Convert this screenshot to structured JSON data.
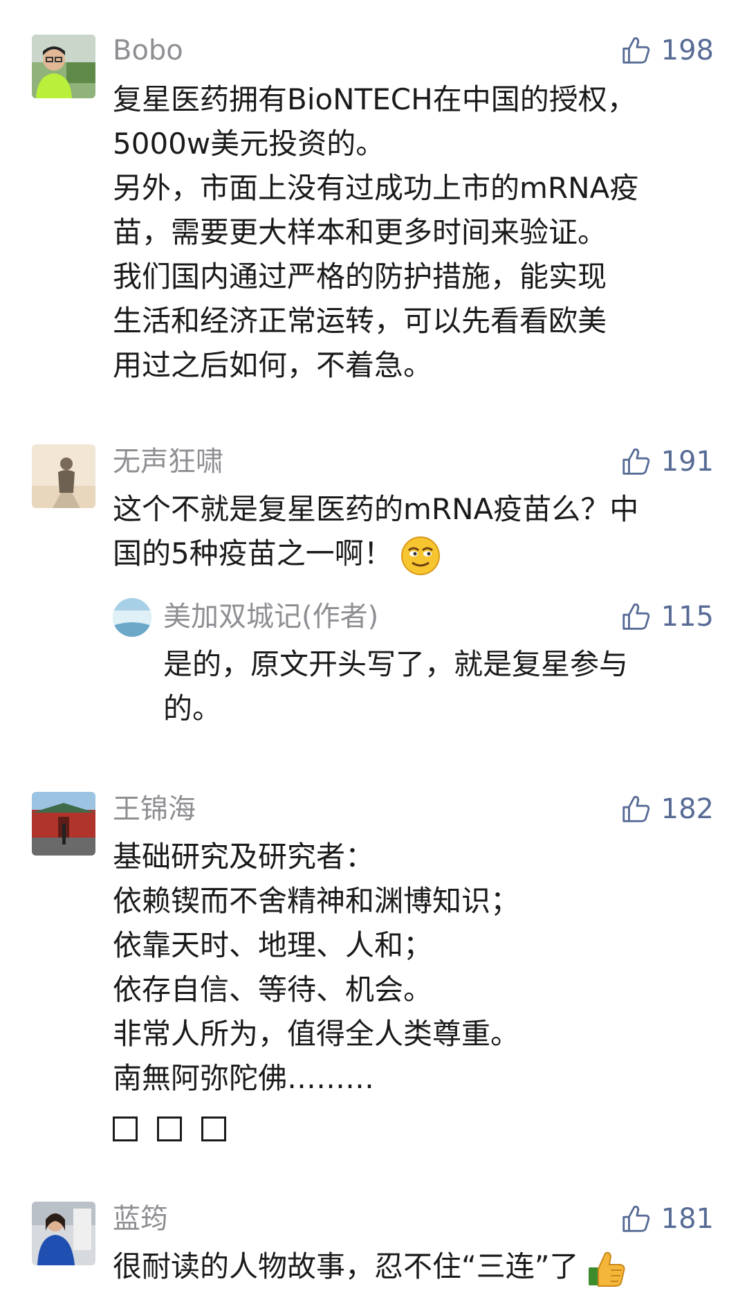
{
  "comments": [
    {
      "author": "Bobo",
      "likes": "198",
      "lines": [
        "复星医药拥有BioNTECH在中国的授权，",
        "5000w美元投资的。",
        "另外，市面上没有过成功上市的mRNA疫",
        "苗，需要更大样本和更多时间来验证。",
        "我们国内通过严格的防护措施，能实现",
        "生活和经济正常运转，可以先看看欧美",
        "用过之后如何，不着急。"
      ]
    },
    {
      "author": "无声狂啸",
      "likes": "191",
      "lines": [
        "这个不就是复星医药的mRNA疫苗么？中",
        "国的5种疫苗之一啊！"
      ],
      "reply": {
        "author": "美加双城记(作者)",
        "likes": "115",
        "lines": [
          "是的，原文开头写了，就是复星参与",
          "的。"
        ]
      }
    },
    {
      "author": "王锦海",
      "likes": "182",
      "lines": [
        "基础研究及研究者：",
        "依赖锲而不舍精神和渊博知识；",
        "依靠天时、地理、人和；",
        "依存自信、等待、机会。",
        "非常人所为，值得全人类尊重。",
        "南無阿弥陀佛………"
      ]
    },
    {
      "author": "蓝筠",
      "likes": "181",
      "lines": [
        "很耐读的人物故事，忍不住“三连”了"
      ]
    }
  ],
  "colors": {
    "like": "#576b95",
    "name": "#8e8e93",
    "text": "#1a1a1a"
  },
  "icons": {
    "like": "thumbs-up-outline-icon",
    "emoji": "smirk-emoji",
    "thumbs": "thumbs-up-emoji"
  }
}
